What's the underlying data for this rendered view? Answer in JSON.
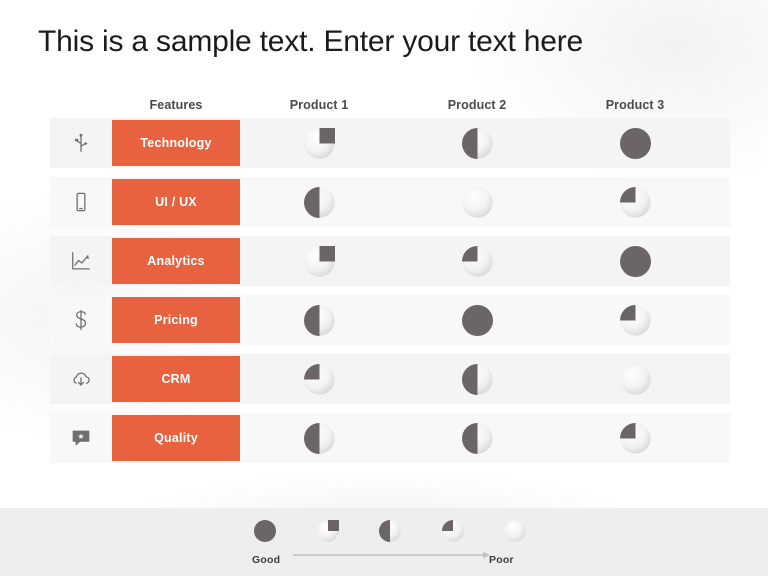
{
  "slide": {
    "title": "This is a sample text. Enter your text here",
    "accent_color": "#e8623f",
    "ball_fill_color": "#6b6565",
    "ball_empty_color": "#ececec",
    "row_band_color": "#f4f4f4",
    "footer_color": "#eeeeee"
  },
  "table": {
    "headers": {
      "icon": "",
      "feature": "Features",
      "product_1": "Product 1",
      "product_2": "Product 2",
      "product_3": "Product 3"
    },
    "rows": [
      {
        "icon": "usb-icon",
        "feature": "Technology",
        "ratings": [
          75,
          50,
          100
        ]
      },
      {
        "icon": "smartphone-icon",
        "feature": "UI / UX",
        "ratings": [
          50,
          0,
          25
        ]
      },
      {
        "icon": "line-chart-icon",
        "feature": "Analytics",
        "ratings": [
          75,
          25,
          100
        ]
      },
      {
        "icon": "dollar-icon",
        "feature": "Pricing",
        "ratings": [
          50,
          100,
          25
        ]
      },
      {
        "icon": "cloud-download-icon",
        "feature": "CRM",
        "ratings": [
          25,
          50,
          0
        ]
      },
      {
        "icon": "speech-bubble-star-icon",
        "feature": "Quality",
        "ratings": [
          50,
          50,
          25
        ]
      }
    ]
  },
  "legend": {
    "scale": [
      100,
      75,
      50,
      25,
      0
    ],
    "best_label": "Good",
    "worst_label": "Poor",
    "arrow": "arrow-right-icon"
  },
  "chart_data": {
    "type": "table",
    "title": "This is a sample text. Enter your text here",
    "categories": [
      "Technology",
      "UI / UX",
      "Analytics",
      "Pricing",
      "CRM",
      "Quality"
    ],
    "series": [
      {
        "name": "Product 1",
        "values": [
          75,
          50,
          75,
          50,
          25,
          50
        ]
      },
      {
        "name": "Product 2",
        "values": [
          50,
          0,
          25,
          100,
          50,
          50
        ]
      },
      {
        "name": "Product 3",
        "values": [
          100,
          25,
          100,
          25,
          0,
          25
        ]
      }
    ],
    "value_encoding": "harvey-ball percent fill; 100 = Good (full), 0 = Poor (empty)",
    "legend": {
      "entries": [
        "Good",
        "Poor"
      ],
      "position": "bottom"
    },
    "ylim": [
      0,
      100
    ],
    "grid": false
  }
}
